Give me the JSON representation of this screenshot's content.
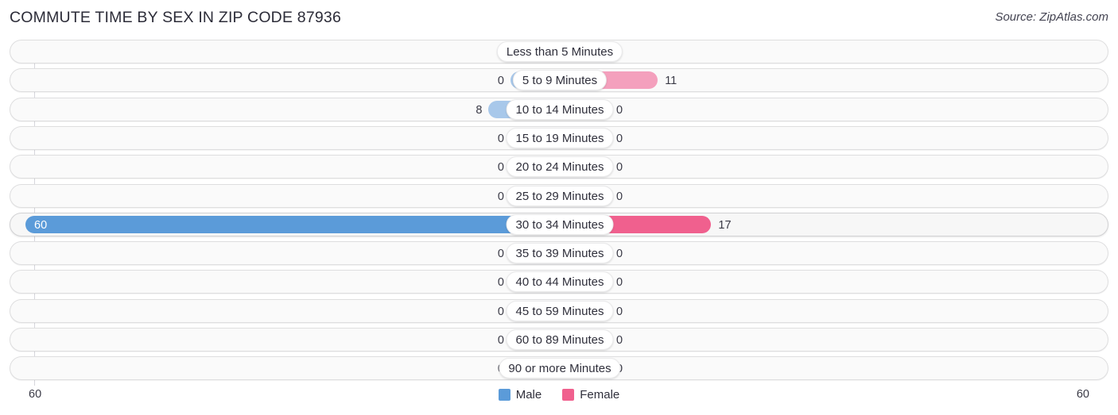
{
  "header": {
    "title": "COMMUTE TIME BY SEX IN ZIP CODE 87936",
    "source": "Source: ZipAtlas.com"
  },
  "legend": {
    "male_label": "Male",
    "female_label": "Female",
    "male_color": "#5b9bd9",
    "female_color": "#f0608e",
    "male_color_muted": "#a8c8ea",
    "female_color_muted": "#f4a0bd"
  },
  "axis": {
    "left_label": "60",
    "right_label": "60",
    "max": 60
  },
  "chart_data": {
    "type": "bar",
    "title": "COMMUTE TIME BY SEX IN ZIP CODE 87936",
    "subtitle": "",
    "xlabel": "",
    "ylabel": "",
    "orientation": "horizontal-diverging",
    "grid": false,
    "legend_position": "bottom-center",
    "axis_max": 60,
    "xlim": [
      60,
      60
    ],
    "categories": [
      "Less than 5 Minutes",
      "5 to 9 Minutes",
      "10 to 14 Minutes",
      "15 to 19 Minutes",
      "20 to 24 Minutes",
      "25 to 29 Minutes",
      "30 to 34 Minutes",
      "35 to 39 Minutes",
      "40 to 44 Minutes",
      "45 to 59 Minutes",
      "60 to 89 Minutes",
      "90 or more Minutes"
    ],
    "series": [
      {
        "name": "Male",
        "values": [
          0,
          0,
          8,
          0,
          0,
          0,
          60,
          0,
          0,
          0,
          0,
          0
        ]
      },
      {
        "name": "Female",
        "values": [
          0,
          11,
          0,
          0,
          0,
          0,
          17,
          0,
          0,
          0,
          0,
          0
        ]
      }
    ],
    "highlighted_category": "30 to 34 Minutes"
  },
  "rows": [
    {
      "label": "Less than 5 Minutes",
      "male": "0",
      "female": "0",
      "male_value": 0,
      "female_value": 0,
      "highlight": false
    },
    {
      "label": "5 to 9 Minutes",
      "male": "0",
      "female": "11",
      "male_value": 0,
      "female_value": 11,
      "highlight": false
    },
    {
      "label": "10 to 14 Minutes",
      "male": "8",
      "female": "0",
      "male_value": 8,
      "female_value": 0,
      "highlight": false
    },
    {
      "label": "15 to 19 Minutes",
      "male": "0",
      "female": "0",
      "male_value": 0,
      "female_value": 0,
      "highlight": false
    },
    {
      "label": "20 to 24 Minutes",
      "male": "0",
      "female": "0",
      "male_value": 0,
      "female_value": 0,
      "highlight": false
    },
    {
      "label": "25 to 29 Minutes",
      "male": "0",
      "female": "0",
      "male_value": 0,
      "female_value": 0,
      "highlight": false
    },
    {
      "label": "30 to 34 Minutes",
      "male": "60",
      "female": "17",
      "male_value": 60,
      "female_value": 17,
      "highlight": true
    },
    {
      "label": "35 to 39 Minutes",
      "male": "0",
      "female": "0",
      "male_value": 0,
      "female_value": 0,
      "highlight": false
    },
    {
      "label": "40 to 44 Minutes",
      "male": "0",
      "female": "0",
      "male_value": 0,
      "female_value": 0,
      "highlight": false
    },
    {
      "label": "45 to 59 Minutes",
      "male": "0",
      "female": "0",
      "male_value": 0,
      "female_value": 0,
      "highlight": false
    },
    {
      "label": "60 to 89 Minutes",
      "male": "0",
      "female": "0",
      "male_value": 0,
      "female_value": 0,
      "highlight": false
    },
    {
      "label": "90 or more Minutes",
      "male": "0",
      "female": "0",
      "male_value": 0,
      "female_value": 0,
      "highlight": false
    }
  ]
}
